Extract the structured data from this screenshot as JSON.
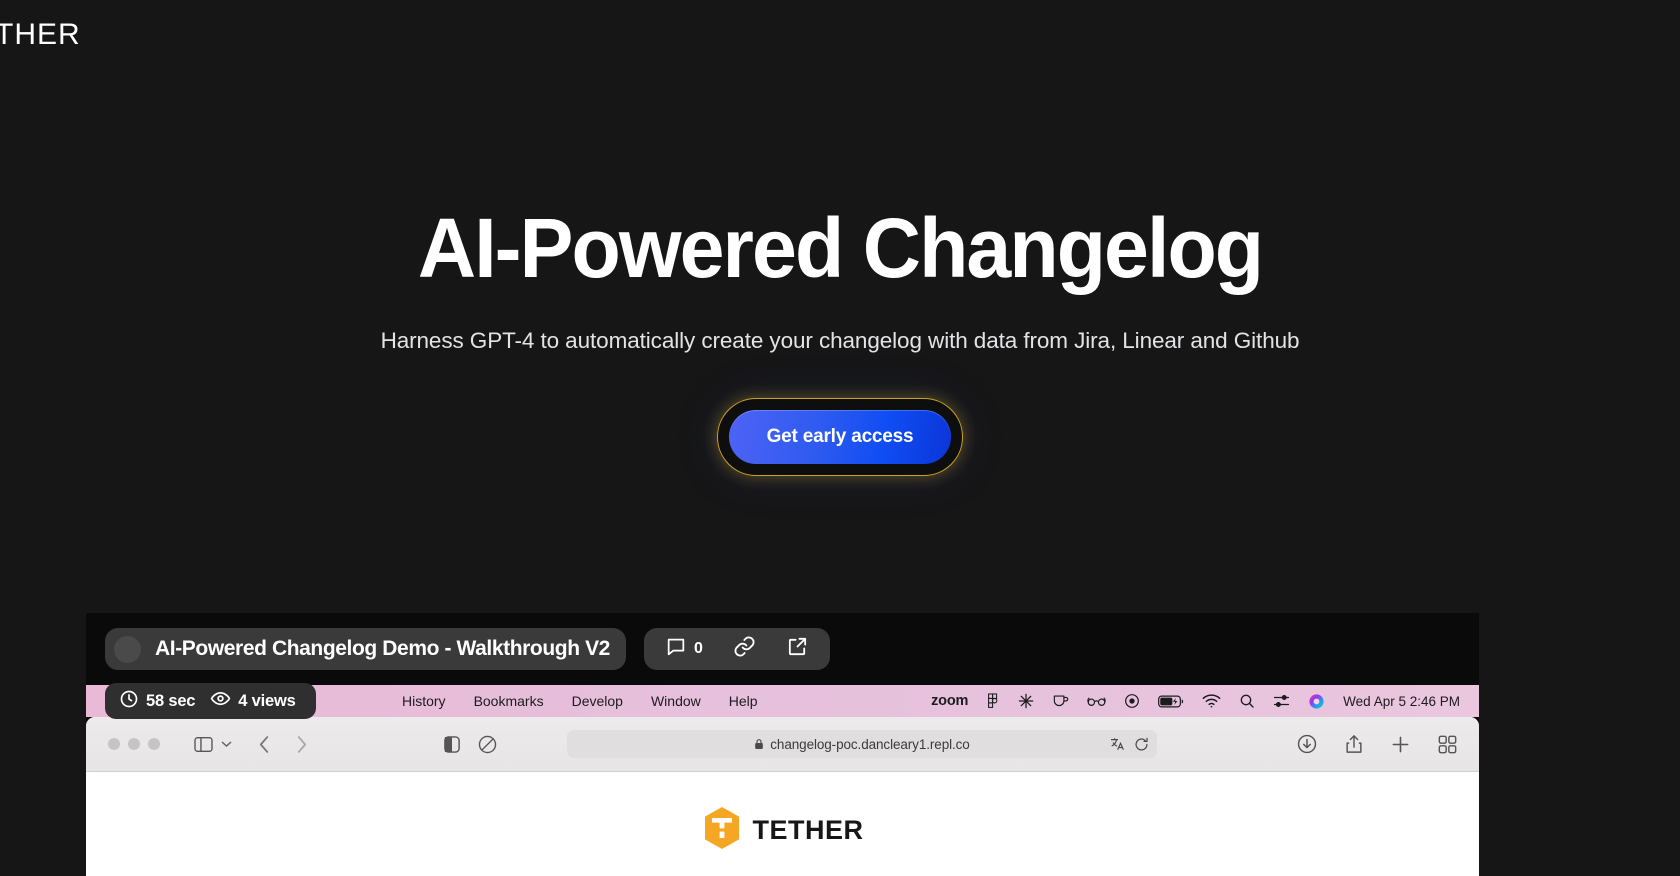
{
  "brand": {
    "visible_text": "ETHER",
    "full_name": "TETHER"
  },
  "hero": {
    "title": "AI-Powered Changelog",
    "subtitle": "Harness GPT-4 to automatically create your changelog with data from Jira, Linear and Github",
    "cta_label": "Get early access",
    "cta_colors": {
      "gradient_start": "#4f63f5",
      "gradient_end": "#0b35d8",
      "ring": "#c9a227"
    },
    "background": "#161616"
  },
  "demo": {
    "title": "AI-Powered Changelog Demo - Walkthrough V2",
    "avatar_icon": "avatar-circle-icon",
    "actions": [
      {
        "icon": "comment-icon",
        "count": "0"
      },
      {
        "icon": "link-icon",
        "count": ""
      },
      {
        "icon": "external-link-icon",
        "count": ""
      }
    ],
    "stats": [
      {
        "icon": "clock-icon",
        "text": "58 sec"
      },
      {
        "icon": "eye-icon",
        "text": "4 views"
      }
    ]
  },
  "menubar": {
    "background_color": "#e7c0dc",
    "items": [
      "History",
      "Bookmarks",
      "Develop",
      "Window",
      "Help"
    ],
    "status_zoom_label": "zoom",
    "status_icons": [
      "figma-icon",
      "snowflake-icon",
      "coffee-cup-icon",
      "glasses-icon",
      "record-circle-icon",
      "battery-charging-icon",
      "wifi-icon",
      "search-icon",
      "control-center-icon",
      "siri-icon"
    ],
    "clock": "Wed Apr 5  2:46 PM"
  },
  "safari": {
    "traffic_lights": [
      "close-button",
      "minimize-button",
      "zoom-button"
    ],
    "toolbar_icons_left": [
      "sidebar-toggle-icon",
      "chevron-down-icon",
      "back-arrow-icon",
      "forward-arrow-icon"
    ],
    "toolbar_icons_center_left": [
      "reader-view-icon",
      "privacy-report-icon"
    ],
    "url": "changelog-poc.dancleary1.repl.co",
    "url_lock_icon": "lock-icon",
    "url_right_icons": [
      "translate-icon",
      "reload-icon"
    ],
    "toolbar_icons_right": [
      "downloads-icon",
      "share-icon",
      "new-tab-icon",
      "tab-overview-icon"
    ],
    "page_logo_text": "TETHER",
    "page_logo_icon": "tether-hexagon-logo",
    "page_logo_color": "#f5a623"
  }
}
